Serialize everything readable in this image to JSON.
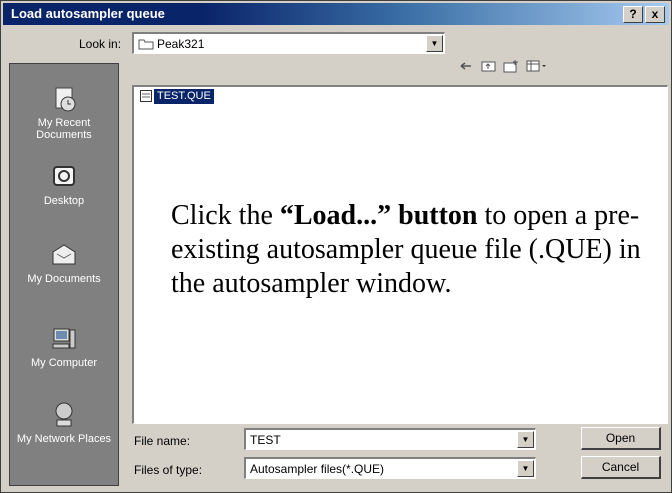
{
  "window": {
    "title": "Load autosampler queue",
    "help_label": "?",
    "close_label": "x"
  },
  "look_in": {
    "label": "Look in:",
    "value": "Peak321"
  },
  "places": [
    {
      "label": "My Recent Documents"
    },
    {
      "label": "Desktop"
    },
    {
      "label": "My Documents"
    },
    {
      "label": "My Computer"
    },
    {
      "label": "My Network Places"
    }
  ],
  "files": [
    {
      "name": "TEST.QUE"
    }
  ],
  "annotation": {
    "prefix": "Click the ",
    "bold": "“Load...” button",
    "suffix": " to open a pre-existing autosampler queue file (.QUE) in the autosampler window."
  },
  "file_name": {
    "label": "File name:",
    "value": "TEST"
  },
  "file_type": {
    "label": "Files of type:",
    "value": "Autosampler files(*.QUE)"
  },
  "buttons": {
    "open": "Open",
    "cancel": "Cancel"
  },
  "colors": {
    "titlebar": "#0a246a",
    "selection": "#0a246a",
    "face": "#d4d0c8",
    "places_bg": "#808080"
  }
}
